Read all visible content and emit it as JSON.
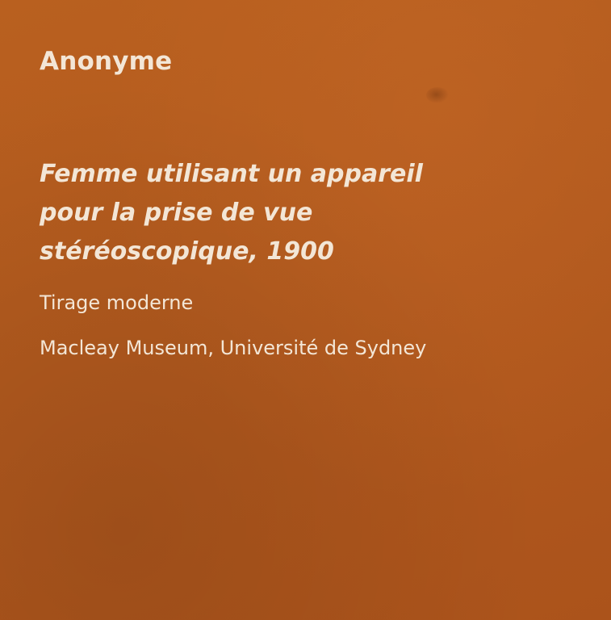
{
  "label": {
    "author": "Anonyme",
    "title_lines": [
      "Femme utilisant un appareil",
      "pour la prise de vue",
      "stéréoscopique, 1900"
    ],
    "medium": "Tirage moderne",
    "credit": "Macleay Museum, Université de Sydney"
  },
  "colors": {
    "background": "#b35a1e",
    "text": "#f3e6d6"
  }
}
